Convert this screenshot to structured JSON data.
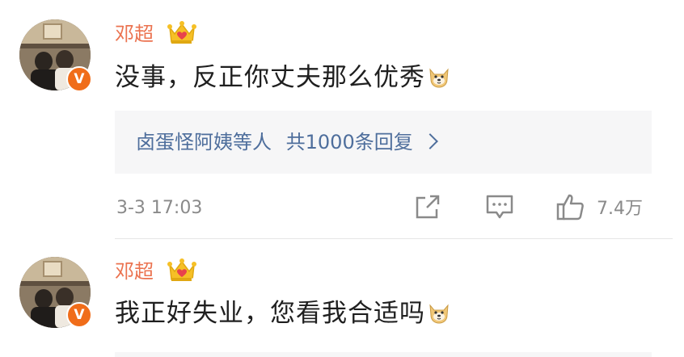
{
  "comments": [
    {
      "user_name": "邓超",
      "badge_icon": "crown-vip-icon",
      "verified_mark": "V",
      "text": "没事，反正你丈夫那么优秀",
      "emoji": "doge-emoji-icon",
      "replies_users": "卤蛋怪阿姨等人",
      "replies_count": "共1000条回复",
      "time": "3-3 17:03",
      "like_count": "7.4万"
    },
    {
      "user_name": "邓超",
      "badge_icon": "crown-vip-icon",
      "verified_mark": "V",
      "text": "我正好失业，您看我合适吗",
      "emoji": "doge-emoji-icon"
    }
  ],
  "colors": {
    "name": "#eb7350",
    "link": "#4e6e9c",
    "meta": "#8a8a8a",
    "verified": "#f06d1a"
  }
}
